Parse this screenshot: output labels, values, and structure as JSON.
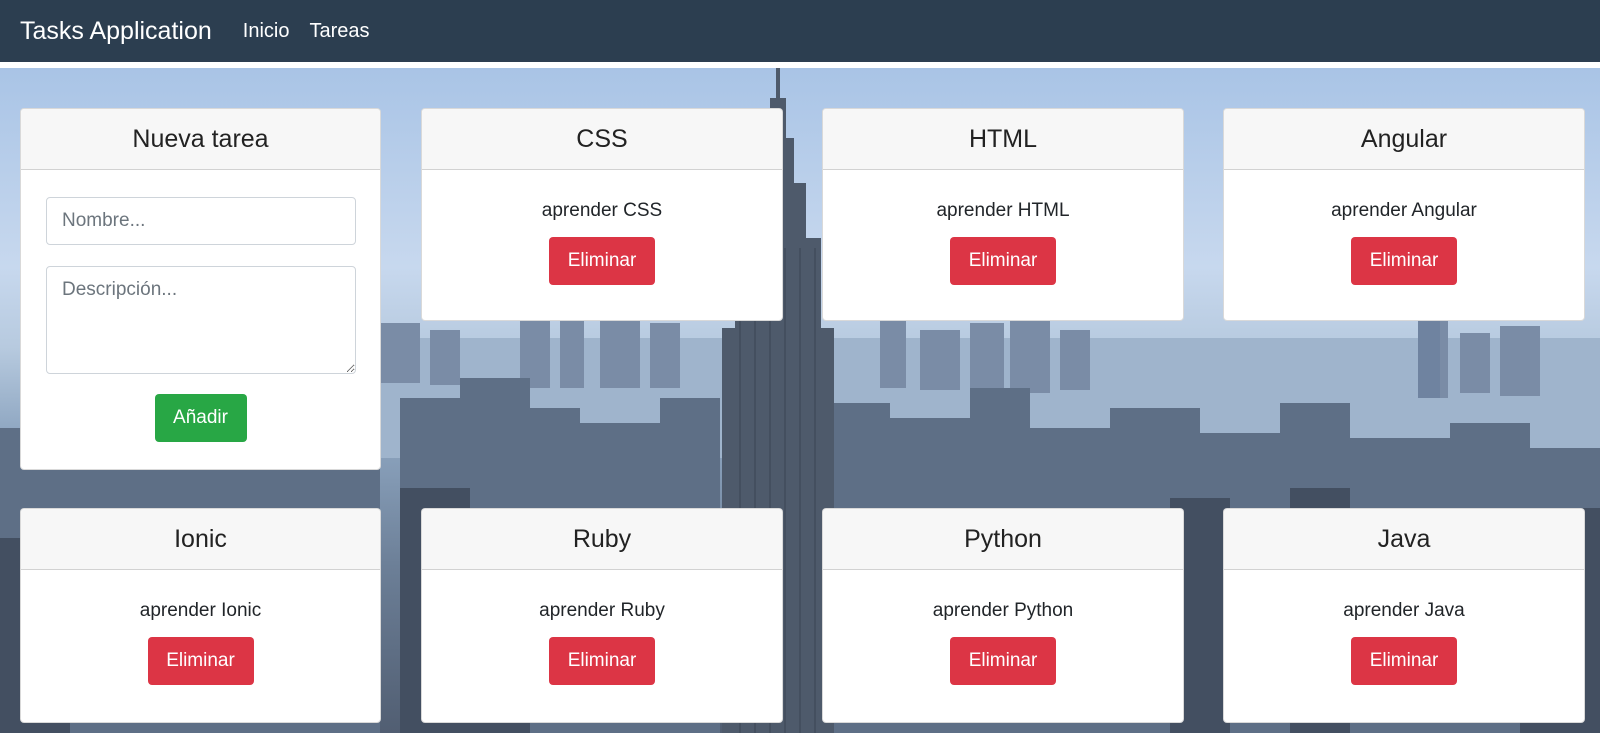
{
  "navbar": {
    "brand": "Tasks Application",
    "links": [
      "Inicio",
      "Tareas"
    ]
  },
  "new_task": {
    "title": "Nueva tarea",
    "name_placeholder": "Nombre...",
    "description_placeholder": "Descripción...",
    "add_label": "Añadir"
  },
  "tasks": [
    {
      "title": "CSS",
      "description": "aprender CSS",
      "delete_label": "Eliminar"
    },
    {
      "title": "HTML",
      "description": "aprender HTML",
      "delete_label": "Eliminar"
    },
    {
      "title": "Angular",
      "description": "aprender Angular",
      "delete_label": "Eliminar"
    },
    {
      "title": "Ionic",
      "description": "aprender Ionic",
      "delete_label": "Eliminar"
    },
    {
      "title": "Ruby",
      "description": "aprender Ruby",
      "delete_label": "Eliminar"
    },
    {
      "title": "Python",
      "description": "aprender Python",
      "delete_label": "Eliminar"
    },
    {
      "title": "Java",
      "description": "aprender Java",
      "delete_label": "Eliminar"
    }
  ],
  "colors": {
    "navbar": "#2c3e50",
    "delete_button": "#dc3545",
    "add_button": "#28a745"
  }
}
